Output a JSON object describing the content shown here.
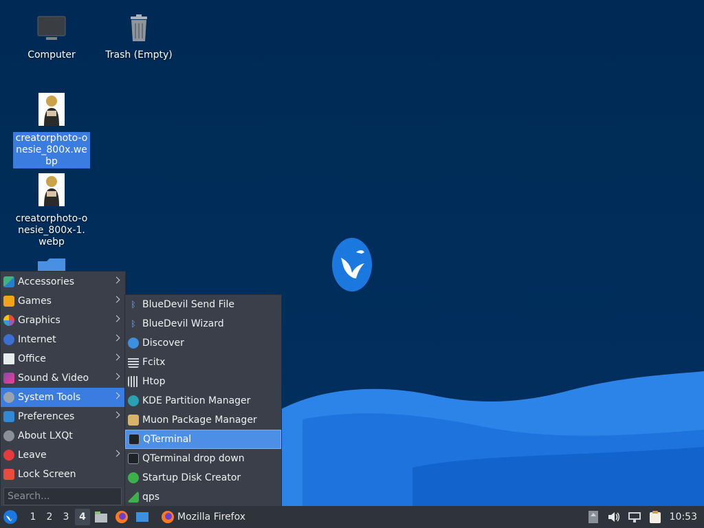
{
  "desktop": {
    "icons": [
      {
        "label": "Computer"
      },
      {
        "label": "Trash (Empty)"
      },
      {
        "label": "creatorphoto-onesie_800x.webp"
      },
      {
        "label": "creatorphoto-onesie_800x-1.webp"
      }
    ]
  },
  "main_menu": {
    "items": [
      {
        "label": "Accessories",
        "icon": "accessories-icon"
      },
      {
        "label": "Games",
        "icon": "games-icon"
      },
      {
        "label": "Graphics",
        "icon": "graphics-icon"
      },
      {
        "label": "Internet",
        "icon": "internet-icon"
      },
      {
        "label": "Office",
        "icon": "office-icon"
      },
      {
        "label": "Sound & Video",
        "icon": "sound-video-icon"
      },
      {
        "label": "System Tools",
        "icon": "system-tools-icon"
      },
      {
        "label": "Preferences",
        "icon": "preferences-icon"
      },
      {
        "label": "About LXQt",
        "icon": "info-icon"
      },
      {
        "label": "Leave",
        "icon": "power-icon"
      },
      {
        "label": "Lock Screen",
        "icon": "lock-icon"
      }
    ],
    "search_placeholder": "Search..."
  },
  "system_tools_menu": {
    "items": [
      {
        "label": "BlueDevil Send File"
      },
      {
        "label": "BlueDevil Wizard"
      },
      {
        "label": "Discover"
      },
      {
        "label": "Fcitx"
      },
      {
        "label": "Htop"
      },
      {
        "label": "KDE Partition Manager"
      },
      {
        "label": "Muon Package Manager"
      },
      {
        "label": "QTerminal"
      },
      {
        "label": "QTerminal drop down"
      },
      {
        "label": "Startup Disk Creator"
      },
      {
        "label": "qps"
      }
    ]
  },
  "taskbar": {
    "desktops": [
      "1",
      "2",
      "3",
      "4"
    ],
    "current_desktop": "4",
    "task_label": "Mozilla Firefox",
    "clock": "10:53"
  },
  "colors": {
    "desktop_bg": "#012a55",
    "accent": "#3b7ce0",
    "menu_bg": "#3a3f4a",
    "taskbar_bg": "#2f333b"
  }
}
